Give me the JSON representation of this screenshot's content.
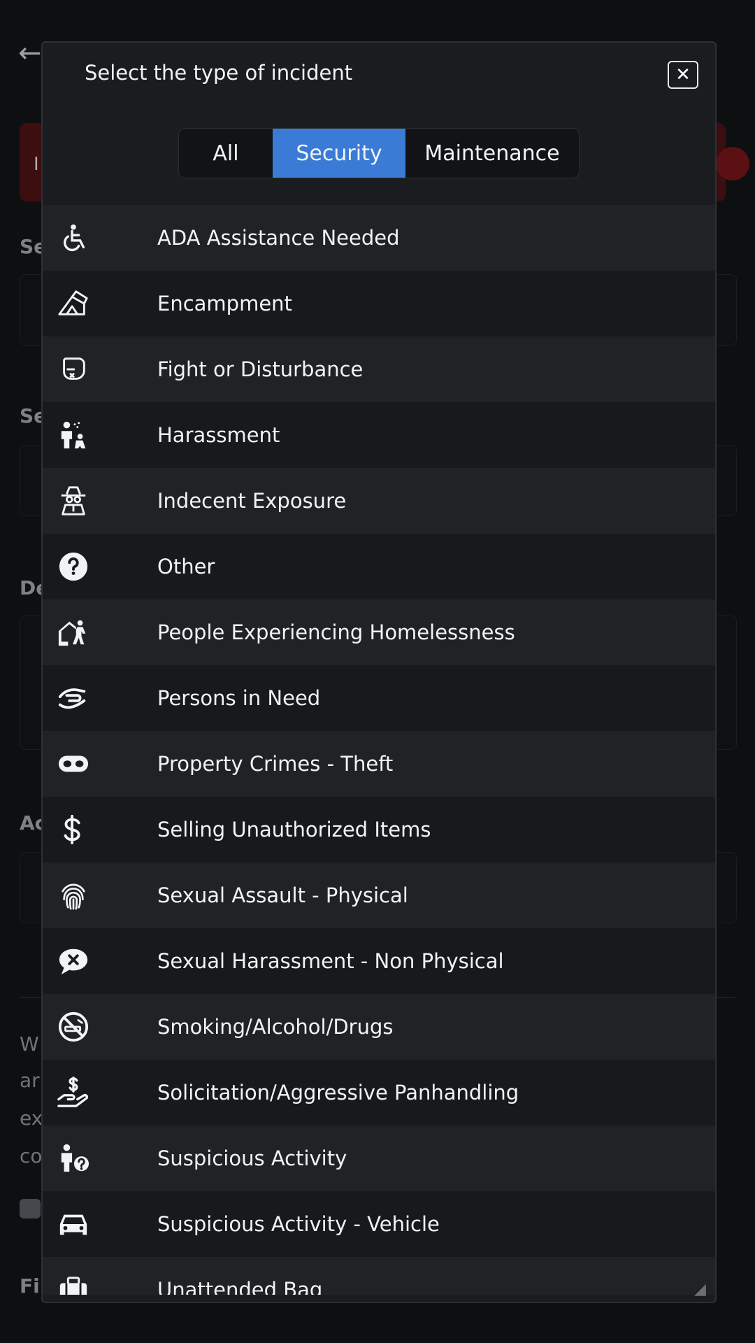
{
  "modal": {
    "title": "Select the type of incident",
    "close_glyph": "✕",
    "tabs": [
      {
        "label": "All",
        "active": false
      },
      {
        "label": "Security",
        "active": true
      },
      {
        "label": "Maintenance",
        "active": false
      }
    ],
    "items": [
      {
        "label": "ADA Assistance Needed",
        "icon": "wheelchair-icon"
      },
      {
        "label": "Encampment",
        "icon": "tent-icon"
      },
      {
        "label": "Fight or Disturbance",
        "icon": "boxing-glove-icon"
      },
      {
        "label": "Harassment",
        "icon": "harassment-icon"
      },
      {
        "label": "Indecent Exposure",
        "icon": "spy-icon"
      },
      {
        "label": "Other",
        "icon": "question-circle-icon"
      },
      {
        "label": "People Experiencing Homelessness",
        "icon": "house-person-icon"
      },
      {
        "label": "Persons in Need",
        "icon": "helping-hand-icon"
      },
      {
        "label": "Property Crimes - Theft",
        "icon": "mask-icon"
      },
      {
        "label": "Selling Unauthorized Items",
        "icon": "dollar-icon"
      },
      {
        "label": "Sexual Assault - Physical",
        "icon": "fingerprint-icon"
      },
      {
        "label": "Sexual Harassment - Non Physical",
        "icon": "comment-x-icon"
      },
      {
        "label": "Smoking/Alcohol/Drugs",
        "icon": "no-smoking-icon"
      },
      {
        "label": "Solicitation/Aggressive Panhandling",
        "icon": "hand-dollar-icon"
      },
      {
        "label": "Suspicious Activity",
        "icon": "person-question-icon"
      },
      {
        "label": "Suspicious Activity - Vehicle",
        "icon": "car-icon"
      },
      {
        "label": "Unattended Bag",
        "icon": "suitcase-icon"
      }
    ]
  },
  "background": {
    "back_glyph": "←",
    "alert_text": "I",
    "labels": [
      "Se",
      "Se",
      "De",
      "Ac",
      "Fi"
    ],
    "paragraph": [
      "W",
      "ar",
      "ex",
      "co"
    ]
  },
  "colors": {
    "accent": "#3a7bd5",
    "modal_bg": "#1a1c20",
    "row_odd": "#202226",
    "row_even": "#17191c"
  }
}
